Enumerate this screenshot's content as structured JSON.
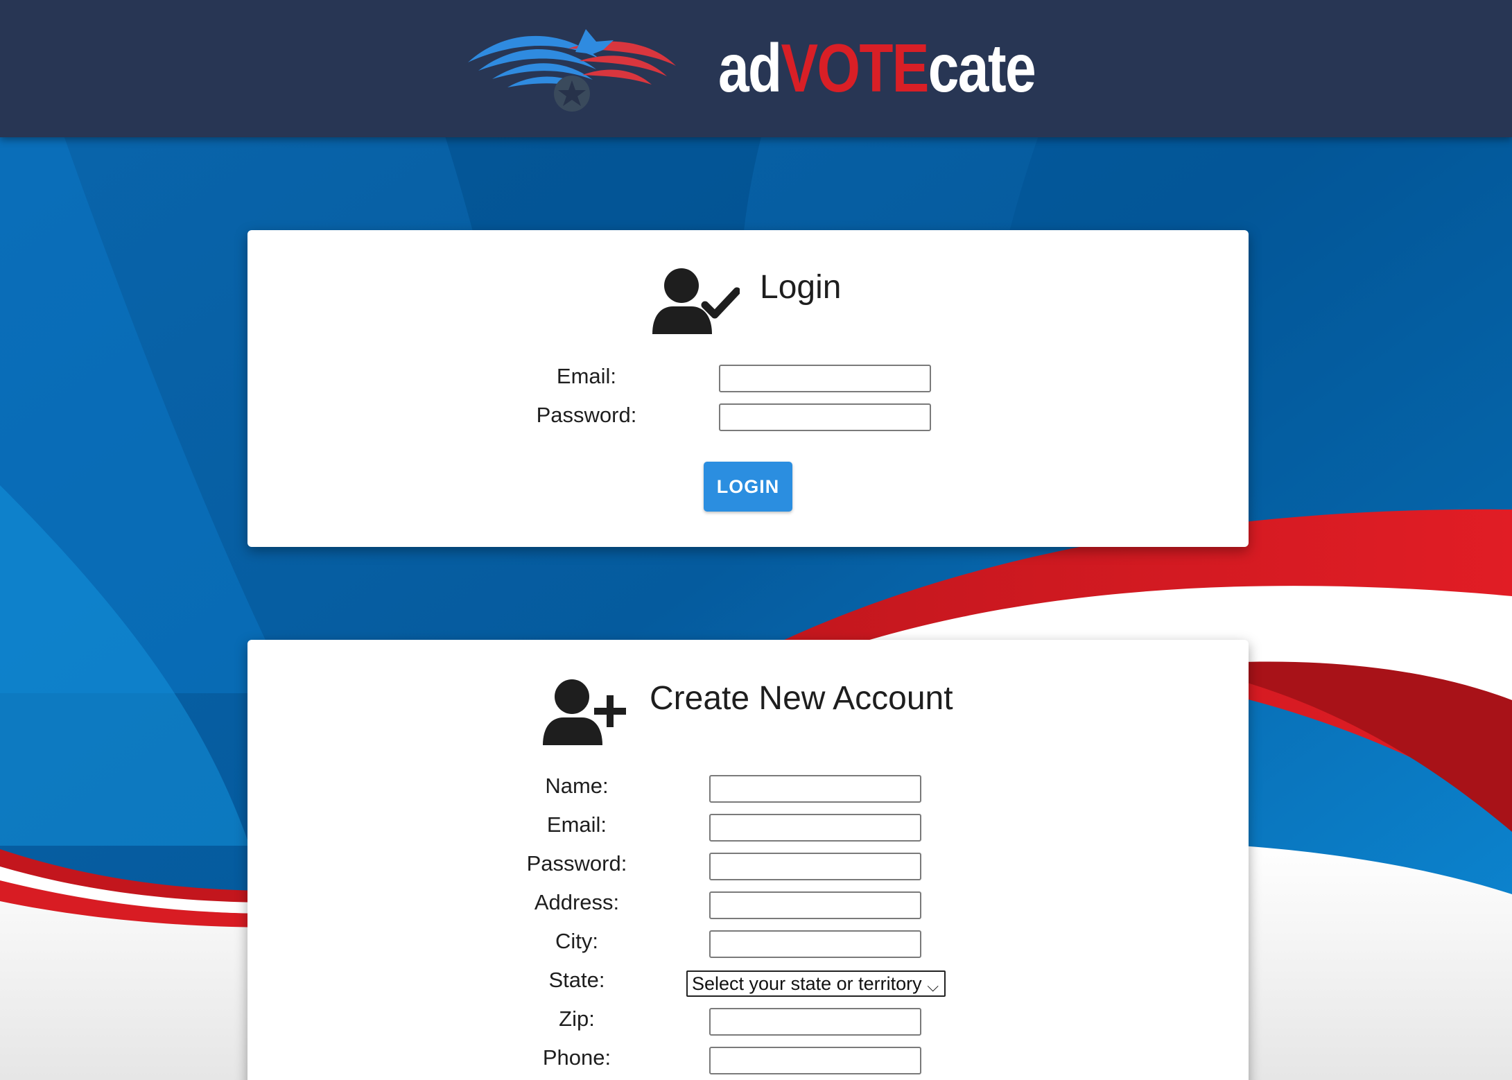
{
  "brand": {
    "word_prefix": "ad",
    "word_highlight": "VOTE",
    "word_suffix": "cate",
    "colors": {
      "header": "#283654",
      "red": "#d91f26",
      "blue": "#2f8be0",
      "button": "#2b8ee0"
    }
  },
  "login": {
    "title": "Login",
    "icon": "user-check-icon",
    "email_label": "Email:",
    "email_value": "",
    "password_label": "Password:",
    "password_value": "",
    "button_label": "LOGIN"
  },
  "signup": {
    "title": "Create New Account",
    "icon": "user-plus-icon",
    "name_label": "Name:",
    "email_label": "Email:",
    "password_label": "Password:",
    "address_label": "Address:",
    "city_label": "City:",
    "state_label": "State:",
    "state_selected": "Select your state or territory",
    "zip_label": "Zip:",
    "phone_label": "Phone:"
  }
}
